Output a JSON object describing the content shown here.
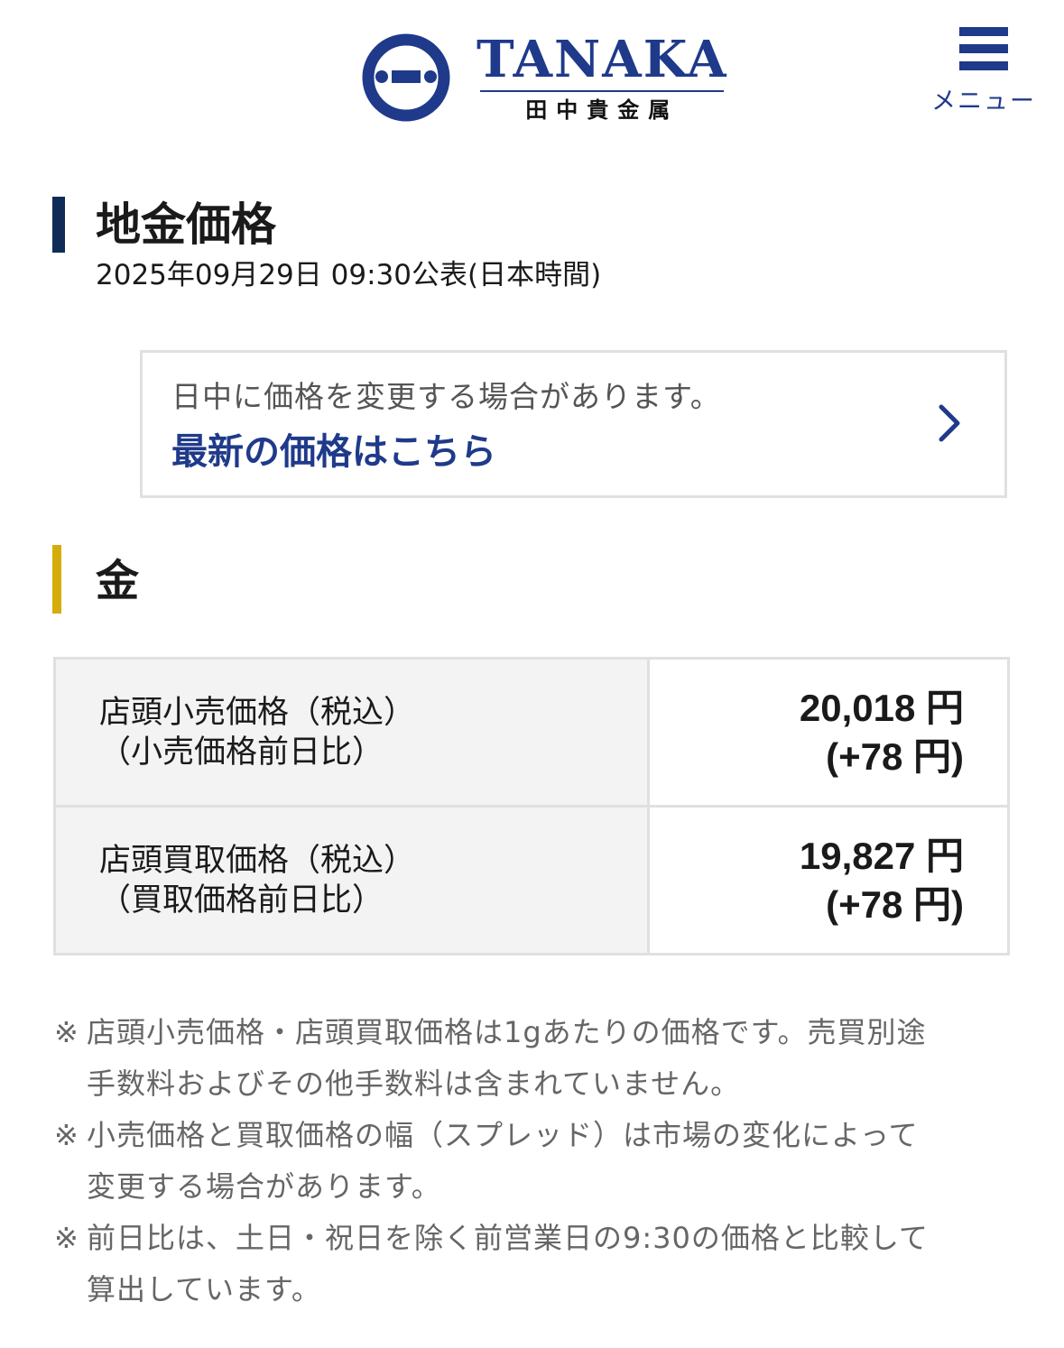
{
  "header": {
    "brand_en": "TANAKA",
    "brand_ja": "田中貴金属",
    "menu_label": "メニュー",
    "brand_color": "#1f3a8a",
    "icons": [
      "tanaka-emblem-icon",
      "hamburger-menu-icon"
    ]
  },
  "page": {
    "title": "地金価格",
    "published": "2025年09月29日 09:30公表(日本時間)"
  },
  "notice": {
    "text": "日中に価格を変更する場合があります。",
    "link_label": "最新の価格はこちら",
    "icon": "chevron-right-icon"
  },
  "section": {
    "title": "金",
    "accent_color": "#d4ad0c"
  },
  "prices": [
    {
      "label_line1": "店頭小売価格（税込）",
      "label_line2": "（小売価格前日比）",
      "value": "20,018 円",
      "change": "(+78 円)"
    },
    {
      "label_line1": "店頭買取価格（税込）",
      "label_line2": "（買取価格前日比）",
      "value": "19,827 円",
      "change": "(+78 円)"
    }
  ],
  "notes": [
    {
      "mark": "※",
      "line1": "店頭小売価格・店頭買取価格は1gあたりの価格です。売買別途",
      "line2": "手数料およびその他手数料は含まれていません。"
    },
    {
      "mark": "※",
      "line1": "小売価格と買取価格の幅（スプレッド）は市場の変化によって",
      "line2": "変更する場合があります。"
    },
    {
      "mark": "※",
      "line1": "前日比は、土日・祝日を除く前営業日の9:30の価格と比較して",
      "line2": "算出しています。"
    }
  ]
}
